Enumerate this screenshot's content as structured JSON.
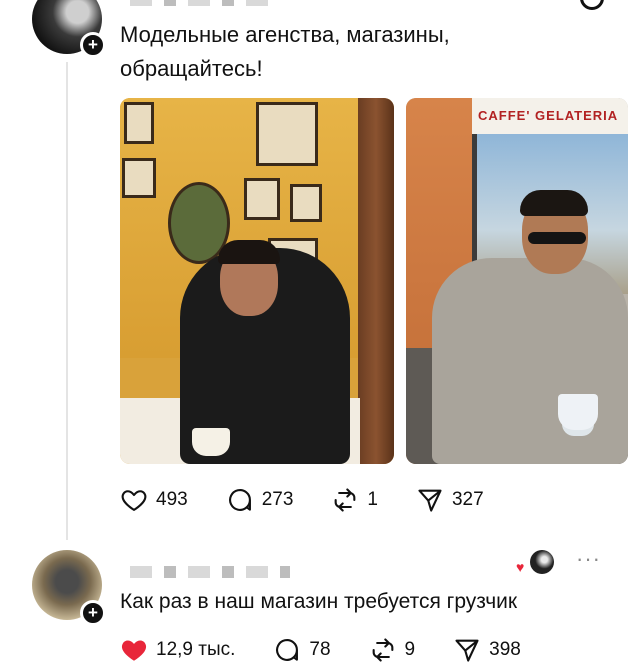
{
  "post": {
    "text": "Модельные агенства, магазины, обращайтесь!",
    "photo_sign": "CAFFE' GELATERIA",
    "actions": {
      "likes": "493",
      "replies": "273",
      "reposts": "1",
      "shares": "327"
    }
  },
  "reply": {
    "text": "Как раз в наш магазин требуется грузчик",
    "actions": {
      "likes": "12,9 тыс.",
      "replies": "78",
      "reposts": "9",
      "shares": "398"
    },
    "like_color": "#e8263a"
  },
  "icons": {
    "like": "heart-icon",
    "reply": "comment-icon",
    "repost": "repost-icon",
    "share": "send-icon",
    "more": "more-icon",
    "follow": "plus-icon"
  }
}
